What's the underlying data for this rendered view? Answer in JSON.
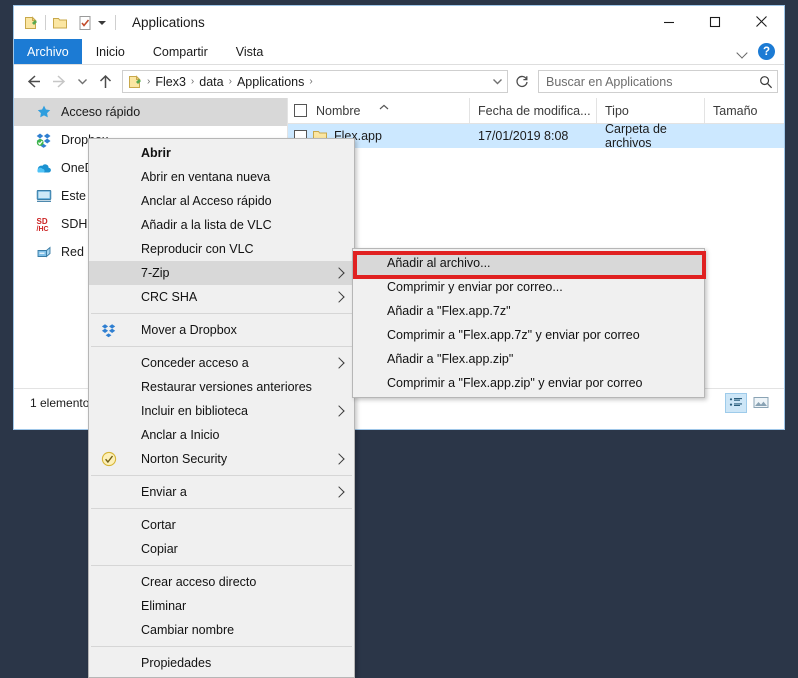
{
  "window": {
    "title": "Applications",
    "quick_access_icons": [
      "folder-page-icon",
      "folder-icon",
      "checked-doc-icon",
      "qat-dropdown-icon"
    ],
    "buttons": {
      "minimize": "minimize-icon",
      "maximize": "maximize-icon",
      "close": "close-icon"
    }
  },
  "ribbon": {
    "tabs": [
      {
        "label": "Archivo",
        "selected": true
      },
      {
        "label": "Inicio",
        "selected": false
      },
      {
        "label": "Compartir",
        "selected": false
      },
      {
        "label": "Vista",
        "selected": false
      }
    ],
    "collapse_icon": "chevron-down-icon",
    "help_label": "?"
  },
  "address": {
    "back_icon": "arrow-left-icon",
    "forward_icon": "arrow-right-icon",
    "recent_icon": "chevron-down-icon",
    "up_icon": "arrow-up-icon",
    "breadcrumb": [
      "Flex3",
      "data",
      "Applications"
    ],
    "breadcrumb_separator": "›",
    "dropdown_icon": "chevron-down-icon",
    "refresh_icon": "refresh-icon",
    "search_placeholder": "Buscar en Applications",
    "search_value": "",
    "search_icon": "search-icon"
  },
  "nav_pane": {
    "items": [
      {
        "label": "Acceso rápido",
        "icon": "star-pin-icon",
        "selected": true
      },
      {
        "label": "Dropbox",
        "icon": "dropbox-icon",
        "selected": false
      },
      {
        "label": "OneDrive",
        "icon": "onedrive-cloud-icon",
        "selected": false
      },
      {
        "label": "Este equipo",
        "icon": "this-pc-icon",
        "selected": false
      },
      {
        "label": "SDHC (F:)",
        "icon": "sd-card-icon",
        "selected": false
      },
      {
        "label": "Red",
        "icon": "network-icon",
        "selected": false
      }
    ]
  },
  "file_list": {
    "columns": [
      {
        "label": "Nombre",
        "sorted": true,
        "sort_icon": "sort-asc-icon"
      },
      {
        "label": "Fecha de modifica...",
        "sorted": false
      },
      {
        "label": "Tipo",
        "sorted": false
      },
      {
        "label": "Tamaño",
        "sorted": false
      }
    ],
    "rows": [
      {
        "name": "Flex.app",
        "date": "17/01/2019 8:08",
        "type": "Carpeta de archivos",
        "size": "",
        "icon": "folder-icon",
        "selected": true
      }
    ]
  },
  "status_bar": {
    "text": "1 elemento",
    "view_buttons": [
      {
        "name": "details-view-button",
        "icon": "details-view-icon",
        "active": true
      },
      {
        "name": "large-icons-view-button",
        "icon": "thumbnail-view-icon",
        "active": false
      }
    ]
  },
  "context_menu": {
    "items": [
      {
        "label": "Abrir",
        "bold": true,
        "arrow": false,
        "icon": null,
        "highlight": false
      },
      {
        "label": "Abrir en ventana nueva",
        "bold": false,
        "arrow": false,
        "icon": null,
        "highlight": false
      },
      {
        "label": "Anclar al Acceso rápido",
        "bold": false,
        "arrow": false,
        "icon": null,
        "highlight": false
      },
      {
        "label": "Añadir a la lista de VLC",
        "bold": false,
        "arrow": false,
        "icon": null,
        "highlight": false
      },
      {
        "label": "Reproducir con VLC",
        "bold": false,
        "arrow": false,
        "icon": null,
        "highlight": false
      },
      {
        "label": "7-Zip",
        "bold": false,
        "arrow": true,
        "icon": null,
        "highlight": true
      },
      {
        "label": "CRC SHA",
        "bold": false,
        "arrow": true,
        "icon": null,
        "highlight": false
      },
      {
        "separator": true
      },
      {
        "label": "Mover a Dropbox",
        "bold": false,
        "arrow": false,
        "icon": "dropbox-icon",
        "highlight": false
      },
      {
        "separator": true
      },
      {
        "label": "Conceder acceso a",
        "bold": false,
        "arrow": true,
        "icon": null,
        "highlight": false
      },
      {
        "label": "Restaurar versiones anteriores",
        "bold": false,
        "arrow": false,
        "icon": null,
        "highlight": false
      },
      {
        "label": "Incluir en biblioteca",
        "bold": false,
        "arrow": true,
        "icon": null,
        "highlight": false
      },
      {
        "label": "Anclar a Inicio",
        "bold": false,
        "arrow": false,
        "icon": null,
        "highlight": false
      },
      {
        "label": "Norton Security",
        "bold": false,
        "arrow": true,
        "icon": "norton-checkmark-icon",
        "highlight": false
      },
      {
        "separator": true
      },
      {
        "label": "Enviar a",
        "bold": false,
        "arrow": true,
        "icon": null,
        "highlight": false
      },
      {
        "separator": true
      },
      {
        "label": "Cortar",
        "bold": false,
        "arrow": false,
        "icon": null,
        "highlight": false
      },
      {
        "label": "Copiar",
        "bold": false,
        "arrow": false,
        "icon": null,
        "highlight": false
      },
      {
        "separator": true
      },
      {
        "label": "Crear acceso directo",
        "bold": false,
        "arrow": false,
        "icon": null,
        "highlight": false
      },
      {
        "label": "Eliminar",
        "bold": false,
        "arrow": false,
        "icon": null,
        "highlight": false
      },
      {
        "label": "Cambiar nombre",
        "bold": false,
        "arrow": false,
        "icon": null,
        "highlight": false
      },
      {
        "separator": true
      },
      {
        "label": "Propiedades",
        "bold": false,
        "arrow": false,
        "icon": null,
        "highlight": false
      }
    ]
  },
  "submenu": {
    "parent": "7-Zip",
    "highlight_color": "#e02121",
    "items": [
      {
        "label": "Añadir al archivo...",
        "highlight": true
      },
      {
        "label": "Comprimir y enviar por correo...",
        "highlight": false
      },
      {
        "label": "Añadir a \"Flex.app.7z\"",
        "highlight": false
      },
      {
        "label": "Comprimir a \"Flex.app.7z\" y enviar por correo",
        "highlight": false
      },
      {
        "label": "Añadir a \"Flex.app.zip\"",
        "highlight": false
      },
      {
        "label": "Comprimir a \"Flex.app.zip\" y enviar por correo",
        "highlight": false
      }
    ]
  }
}
